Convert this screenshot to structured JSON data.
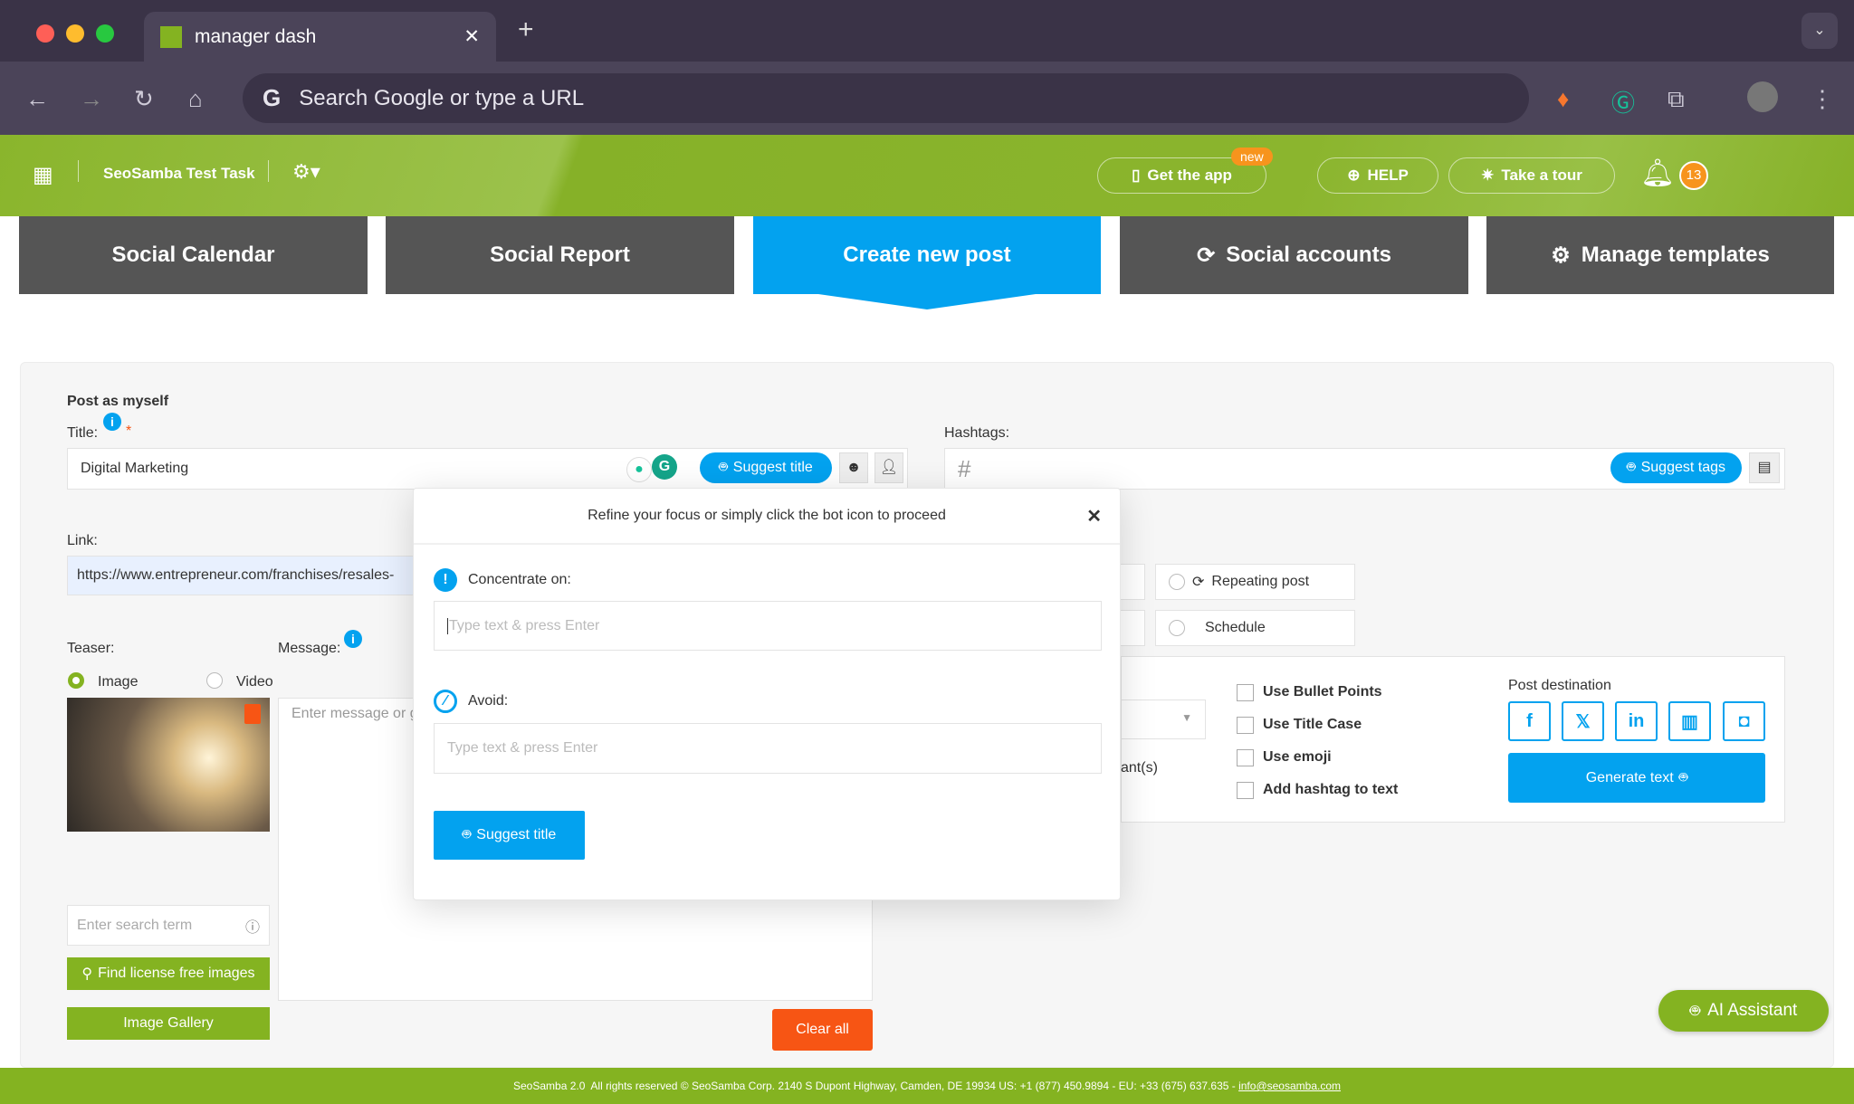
{
  "browser": {
    "tab_title": "manager dash",
    "address_placeholder": "Search Google or type a URL"
  },
  "header": {
    "site_name": "SeoSamba Test Task",
    "get_app": "Get the app",
    "new_badge": "new",
    "help": "HELP",
    "tour": "Take a tour",
    "notif_count": "13"
  },
  "nav": {
    "tabs": [
      {
        "label": "Social Calendar"
      },
      {
        "label": "Social Report"
      },
      {
        "label": "Create new post"
      },
      {
        "label": "Social accounts"
      },
      {
        "label": "Manage templates"
      }
    ]
  },
  "form": {
    "post_as": "Post as myself",
    "title_label": "Title:",
    "required": "*",
    "title_value": "Digital Marketing",
    "suggest_title": "Suggest title",
    "hashtags_label": "Hashtags:",
    "hash_symbol": "#",
    "suggest_tags": "Suggest tags",
    "link_label": "Link:",
    "link_value": "https://www.entrepreneur.com/franchises/resales-",
    "teaser_label": "Teaser:",
    "message_label": "Message:",
    "image_option": "Image",
    "video_option": "Video",
    "teaser_selected": "Image",
    "message_placeholder": "Enter message or g",
    "search_placeholder": "Enter search term",
    "find_images": "Find license free images",
    "image_gallery": "Image Gallery",
    "clear_all": "Clear all",
    "repeating_post": "Repeating post",
    "schedule": "Schedule",
    "participants_fragment": "ant(s)",
    "options": [
      "Use Bullet Points",
      "Use Title Case",
      "Use emoji",
      "Add hashtag to text"
    ],
    "post_destination": "Post destination",
    "destinations": [
      "facebook",
      "x",
      "linkedin",
      "google-business",
      "instagram"
    ],
    "generate_text": "Generate text"
  },
  "popup": {
    "heading": "Refine your focus or simply click the bot icon to proceed",
    "concentrate_label": "Concentrate on:",
    "concentrate_placeholder": "Type text & press Enter",
    "avoid_label": "Avoid:",
    "avoid_placeholder": "Type text & press Enter",
    "suggest_title": "Suggest title"
  },
  "ai_assistant": "AI Assistant",
  "footer": {
    "text": "SeoSamba 2.0  All rights reserved © SeoSamba Corp. 2140 S Dupont Highway, Camden, DE 19934 US: +1 (877) 450.9894 - EU: +33 (675) 637.635 - ",
    "email": "info@seosamba.com"
  },
  "colors": {
    "green": "#84b321",
    "blue": "#03a2ef",
    "orange": "#f75514",
    "tab_gray": "#555555"
  }
}
